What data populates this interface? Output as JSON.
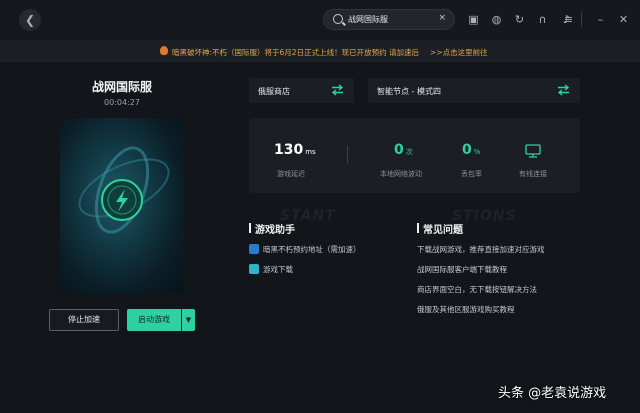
{
  "search": {
    "value": "战网国际服",
    "clear": "×"
  },
  "icons": {
    "back": "chevron-left-icon",
    "search": "search-icon",
    "clear": "close-icon",
    "tray": [
      "message-icon",
      "gamepad-icon",
      "refresh-icon",
      "headset-icon",
      "bell-icon",
      "menu-icon"
    ],
    "window": [
      "minimize-icon",
      "close-icon"
    ]
  },
  "notice": {
    "message": "暗黑破坏神:不朽（国际服）将于6月2日正式上线！现已开放预约 请加速后",
    "link": ">>点击这里前往"
  },
  "game": {
    "title": "战网国际服",
    "elapsed": "00:04:27"
  },
  "buttons": {
    "stop": "停止加速",
    "start": "启动游戏"
  },
  "selectors": {
    "region": "俄服商店",
    "node": "智能节点 - 模式四"
  },
  "stats": {
    "latency": {
      "value": "130",
      "unit": "ms",
      "label": "游戏延迟"
    },
    "jitter": {
      "value": "0",
      "unit": "次",
      "label": "本地网络波动"
    },
    "loss": {
      "value": "0",
      "unit": "%",
      "label": "丢包率"
    },
    "connection": {
      "label": "有线连接"
    }
  },
  "watermarks": {
    "left": "STANT",
    "right": "STIONS"
  },
  "helper": {
    "title": "游戏助手",
    "items": [
      "暗黑不朽预约地址（需加速）",
      "游戏下载"
    ]
  },
  "faq": {
    "title": "常见问题",
    "items": [
      "下载战网游戏，推荐直接加速对应游戏",
      "战网国际服客户端下载教程",
      "商店界面空白，无下载按钮解决方法",
      "俄服及其他区服游戏购买教程"
    ]
  },
  "brand": "头条 @老袁说游戏",
  "colors": {
    "accent": "#2fd1a2",
    "notice": "#e2a64a",
    "background": "#121519"
  }
}
